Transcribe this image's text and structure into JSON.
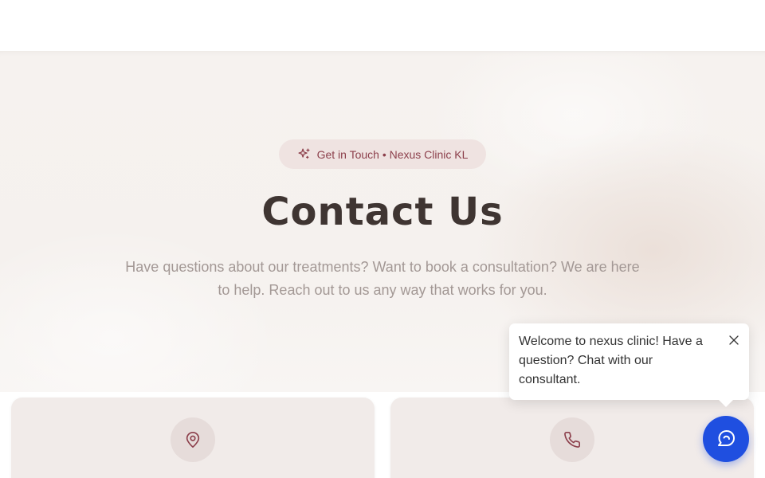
{
  "hero": {
    "badge_label": "Get in Touch • Nexus Clinic KL",
    "title": "Contact Us",
    "subtitle": "Have questions about our treatments? Want to book a consultation? We are here to help. Reach out to us any way that works for you."
  },
  "cards": [
    {
      "icon": "map-pin-icon"
    },
    {
      "icon": "phone-icon"
    }
  ],
  "chat": {
    "welcome_message": "Welcome to nexus clinic! Have a question? Chat with our consultant.",
    "fab_icon": "chat-icon"
  },
  "colors": {
    "accent": "#8c3f4b",
    "heading": "#3f3532",
    "muted_text": "#a39895",
    "chat_button": "#1f4fe0",
    "badge_bg": "#efe3e1"
  }
}
